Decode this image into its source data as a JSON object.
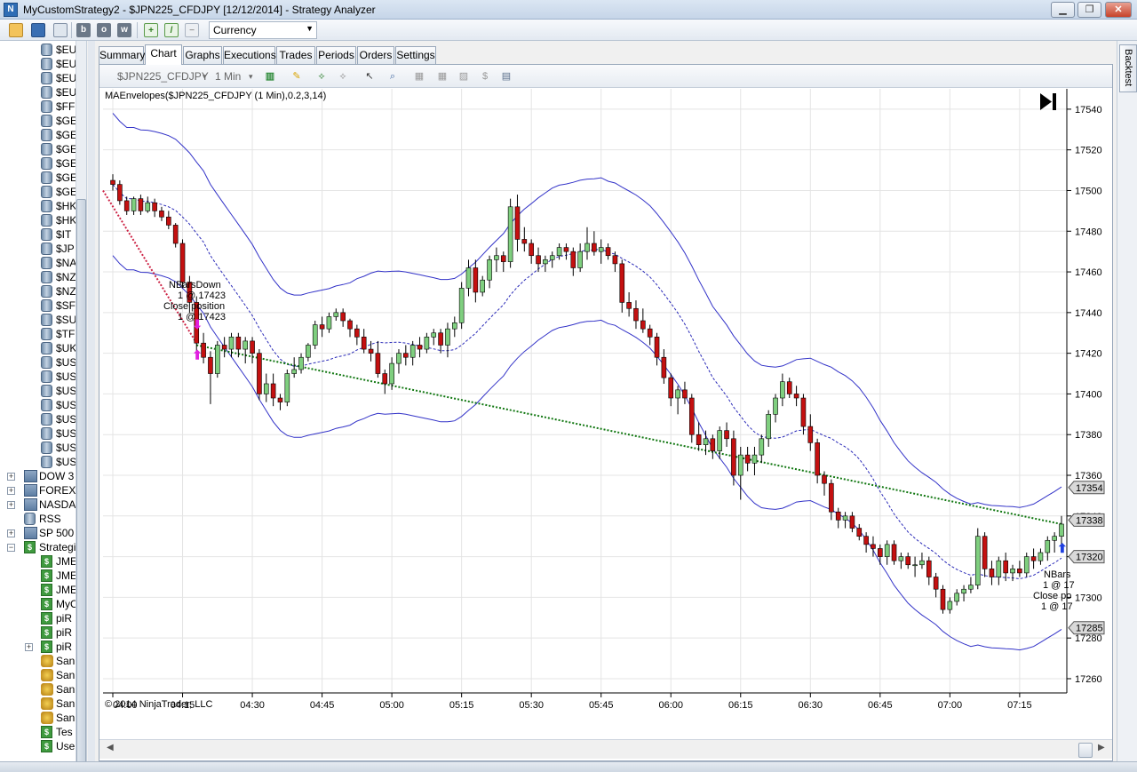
{
  "window": {
    "title": "MyCustomStrategy2 - $JPN225_CFDJPY [12/12/2014] - Strategy Analyzer",
    "minimize_label": "▁",
    "maximize_label": "❐",
    "close_label": "✕"
  },
  "toolbar": {
    "currency_select": "Currency",
    "btn_b": "b",
    "btn_o": "o",
    "btn_w": "w"
  },
  "tree": {
    "instrument_items": [
      "$EU",
      "$EU",
      "$EU",
      "$EU",
      "$FF",
      "$GE",
      "$GE",
      "$GE",
      "$GE",
      "$GE",
      "$GE",
      "$HK",
      "$HK",
      "$IT",
      "$JP",
      "$NA",
      "$NZ",
      "$NZ",
      "$SF",
      "$SU",
      "$TF",
      "$UK",
      "$US",
      "$US",
      "$US",
      "$US",
      "$US",
      "$US",
      "$US",
      "$US"
    ],
    "groups": [
      "DOW 3",
      "FOREX",
      "NASDA",
      "RSS",
      "SP 500",
      "Strategi"
    ],
    "strategies": [
      "JME",
      "JME",
      "JME",
      "MyC",
      "piR",
      "piR",
      "piR",
      "San",
      "San",
      "San",
      "San",
      "San",
      "Tes",
      "Use"
    ]
  },
  "tabs": [
    "Summary",
    "Chart",
    "Graphs",
    "Executions",
    "Trades",
    "Periods",
    "Orders",
    "Settings"
  ],
  "active_tab": "Chart",
  "chart_toolbar": {
    "instrument": "$JPN225_CFDJPY",
    "interval": "1 Min"
  },
  "right_dock": {
    "label": "Backtest"
  },
  "chart_data": {
    "type": "candlestick",
    "indicator_label": "MAEnvelopes($JPN225_CFDJPY (1 Min),0.2,3,14)",
    "copyright": "© 2014 NinjaTrader, LLC",
    "y_ticks": [
      17260,
      17280,
      17300,
      17320,
      17340,
      17360,
      17380,
      17400,
      17420,
      17440,
      17460,
      17480,
      17500,
      17520,
      17540
    ],
    "ylim": [
      17253,
      17550
    ],
    "x_ticks": [
      "04:00",
      "04:15",
      "04:30",
      "04:45",
      "05:00",
      "05:15",
      "05:30",
      "05:45",
      "06:00",
      "06:15",
      "06:30",
      "06:45",
      "07:00",
      "07:15"
    ],
    "price_badges": [
      17354,
      17338,
      17320,
      17285
    ],
    "annotations": {
      "entry_top": [
        "NBarsDown",
        "1 @ 17423",
        "Close position",
        "1 @ 17423"
      ],
      "entry_right": [
        "NBars",
        "1 @ 17",
        "Close po",
        "1 @ 17"
      ]
    },
    "candles": [
      [
        17505,
        17508,
        17500,
        17503
      ],
      [
        17503,
        17505,
        17493,
        17495
      ],
      [
        17495,
        17497,
        17488,
        17490
      ],
      [
        17490,
        17497,
        17488,
        17496
      ],
      [
        17496,
        17498,
        17488,
        17490
      ],
      [
        17490,
        17497,
        17489,
        17494
      ],
      [
        17494,
        17496,
        17487,
        17490
      ],
      [
        17490,
        17492,
        17485,
        17487
      ],
      [
        17487,
        17490,
        17481,
        17483
      ],
      [
        17483,
        17484,
        17472,
        17474
      ],
      [
        17474,
        17476,
        17452,
        17455
      ],
      [
        17455,
        17458,
        17440,
        17445
      ],
      [
        17445,
        17448,
        17420,
        17425
      ],
      [
        17425,
        17430,
        17415,
        17418
      ],
      [
        17418,
        17421,
        17395,
        17410
      ],
      [
        17410,
        17426,
        17408,
        17424
      ],
      [
        17424,
        17428,
        17418,
        17422
      ],
      [
        17422,
        17430,
        17418,
        17428
      ],
      [
        17428,
        17430,
        17418,
        17422
      ],
      [
        17422,
        17428,
        17415,
        17426
      ],
      [
        17426,
        17428,
        17415,
        17420
      ],
      [
        17420,
        17422,
        17397,
        17400
      ],
      [
        17400,
        17410,
        17396,
        17405
      ],
      [
        17405,
        17410,
        17394,
        17398
      ],
      [
        17398,
        17400,
        17392,
        17396
      ],
      [
        17396,
        17412,
        17394,
        17410
      ],
      [
        17410,
        17418,
        17408,
        17412
      ],
      [
        17412,
        17420,
        17410,
        17418
      ],
      [
        17418,
        17425,
        17416,
        17424
      ],
      [
        17424,
        17436,
        17422,
        17434
      ],
      [
        17434,
        17438,
        17428,
        17432
      ],
      [
        17432,
        17440,
        17430,
        17438
      ],
      [
        17438,
        17442,
        17436,
        17440
      ],
      [
        17440,
        17442,
        17433,
        17436
      ],
      [
        17436,
        17437,
        17428,
        17432
      ],
      [
        17432,
        17434,
        17424,
        17428
      ],
      [
        17428,
        17432,
        17420,
        17422
      ],
      [
        17422,
        17426,
        17416,
        17420
      ],
      [
        17420,
        17426,
        17408,
        17410
      ],
      [
        17410,
        17412,
        17400,
        17405
      ],
      [
        17405,
        17418,
        17402,
        17415
      ],
      [
        17415,
        17422,
        17410,
        17420
      ],
      [
        17420,
        17424,
        17414,
        17418
      ],
      [
        17418,
        17426,
        17414,
        17424
      ],
      [
        17424,
        17428,
        17418,
        17422
      ],
      [
        17422,
        17430,
        17420,
        17428
      ],
      [
        17428,
        17432,
        17424,
        17430
      ],
      [
        17430,
        17432,
        17420,
        17424
      ],
      [
        17424,
        17435,
        17418,
        17432
      ],
      [
        17432,
        17438,
        17428,
        17435
      ],
      [
        17435,
        17455,
        17432,
        17452
      ],
      [
        17452,
        17466,
        17448,
        17462
      ],
      [
        17462,
        17466,
        17445,
        17450
      ],
      [
        17450,
        17458,
        17448,
        17456
      ],
      [
        17456,
        17468,
        17452,
        17466
      ],
      [
        17466,
        17472,
        17460,
        17468
      ],
      [
        17468,
        17470,
        17460,
        17465
      ],
      [
        17465,
        17496,
        17462,
        17492
      ],
      [
        17492,
        17498,
        17470,
        17476
      ],
      [
        17476,
        17482,
        17470,
        17474
      ],
      [
        17474,
        17476,
        17464,
        17468
      ],
      [
        17468,
        17472,
        17460,
        17464
      ],
      [
        17464,
        17468,
        17460,
        17466
      ],
      [
        17466,
        17470,
        17462,
        17468
      ],
      [
        17468,
        17474,
        17466,
        17472
      ],
      [
        17472,
        17474,
        17466,
        17470
      ],
      [
        17470,
        17472,
        17458,
        17462
      ],
      [
        17462,
        17474,
        17460,
        17470
      ],
      [
        17470,
        17482,
        17466,
        17474
      ],
      [
        17474,
        17480,
        17468,
        17470
      ],
      [
        17470,
        17476,
        17464,
        17472
      ],
      [
        17472,
        17474,
        17466,
        17468
      ],
      [
        17468,
        17470,
        17460,
        17464
      ],
      [
        17464,
        17466,
        17440,
        17445
      ],
      [
        17445,
        17450,
        17438,
        17442
      ],
      [
        17442,
        17446,
        17432,
        17436
      ],
      [
        17436,
        17442,
        17430,
        17432
      ],
      [
        17432,
        17434,
        17424,
        17428
      ],
      [
        17428,
        17430,
        17414,
        17418
      ],
      [
        17418,
        17422,
        17405,
        17408
      ],
      [
        17408,
        17410,
        17394,
        17398
      ],
      [
        17398,
        17404,
        17390,
        17402
      ],
      [
        17402,
        17406,
        17395,
        17398
      ],
      [
        17398,
        17400,
        17376,
        17380
      ],
      [
        17380,
        17386,
        17372,
        17375
      ],
      [
        17375,
        17382,
        17370,
        17378
      ],
      [
        17378,
        17380,
        17368,
        17372
      ],
      [
        17372,
        17384,
        17368,
        17382
      ],
      [
        17382,
        17386,
        17374,
        17378
      ],
      [
        17378,
        17382,
        17355,
        17360
      ],
      [
        17360,
        17374,
        17348,
        17370
      ],
      [
        17370,
        17374,
        17362,
        17366
      ],
      [
        17366,
        17374,
        17360,
        17370
      ],
      [
        17370,
        17380,
        17366,
        17378
      ],
      [
        17378,
        17392,
        17374,
        17390
      ],
      [
        17390,
        17400,
        17386,
        17398
      ],
      [
        17398,
        17410,
        17394,
        17406
      ],
      [
        17406,
        17408,
        17398,
        17400
      ],
      [
        17400,
        17404,
        17394,
        17398
      ],
      [
        17398,
        17400,
        17380,
        17384
      ],
      [
        17384,
        17390,
        17372,
        17376
      ],
      [
        17376,
        17378,
        17356,
        17360
      ],
      [
        17360,
        17362,
        17350,
        17356
      ],
      [
        17356,
        17358,
        17338,
        17342
      ],
      [
        17342,
        17344,
        17334,
        17338
      ],
      [
        17338,
        17342,
        17334,
        17340
      ],
      [
        17340,
        17342,
        17332,
        17334
      ],
      [
        17334,
        17336,
        17328,
        17330
      ],
      [
        17330,
        17332,
        17322,
        17326
      ],
      [
        17326,
        17330,
        17320,
        17324
      ],
      [
        17324,
        17326,
        17316,
        17320
      ],
      [
        17320,
        17328,
        17316,
        17326
      ],
      [
        17326,
        17328,
        17316,
        17318
      ],
      [
        17318,
        17322,
        17314,
        17320
      ],
      [
        17320,
        17322,
        17314,
        17316
      ],
      [
        17316,
        17320,
        17310,
        17316
      ],
      [
        17316,
        17322,
        17314,
        17318
      ],
      [
        17318,
        17320,
        17306,
        17310
      ],
      [
        17310,
        17312,
        17300,
        17304
      ],
      [
        17304,
        17306,
        17292,
        17294
      ],
      [
        17294,
        17300,
        17292,
        17298
      ],
      [
        17298,
        17304,
        17296,
        17302
      ],
      [
        17302,
        17306,
        17298,
        17304
      ],
      [
        17304,
        17310,
        17302,
        17306
      ],
      [
        17306,
        17334,
        17304,
        17330
      ],
      [
        17330,
        17332,
        17310,
        17314
      ],
      [
        17314,
        17318,
        17306,
        17310
      ],
      [
        17310,
        17320,
        17306,
        17318
      ],
      [
        17318,
        17322,
        17308,
        17312
      ],
      [
        17312,
        17316,
        17308,
        17314
      ],
      [
        17314,
        17318,
        17310,
        17312
      ],
      [
        17312,
        17322,
        17310,
        17320
      ],
      [
        17320,
        17324,
        17314,
        17318
      ],
      [
        17318,
        17324,
        17316,
        17322
      ],
      [
        17322,
        17330,
        17318,
        17328
      ],
      [
        17328,
        17332,
        17322,
        17330
      ],
      [
        17330,
        17340,
        17326,
        17336
      ]
    ]
  }
}
